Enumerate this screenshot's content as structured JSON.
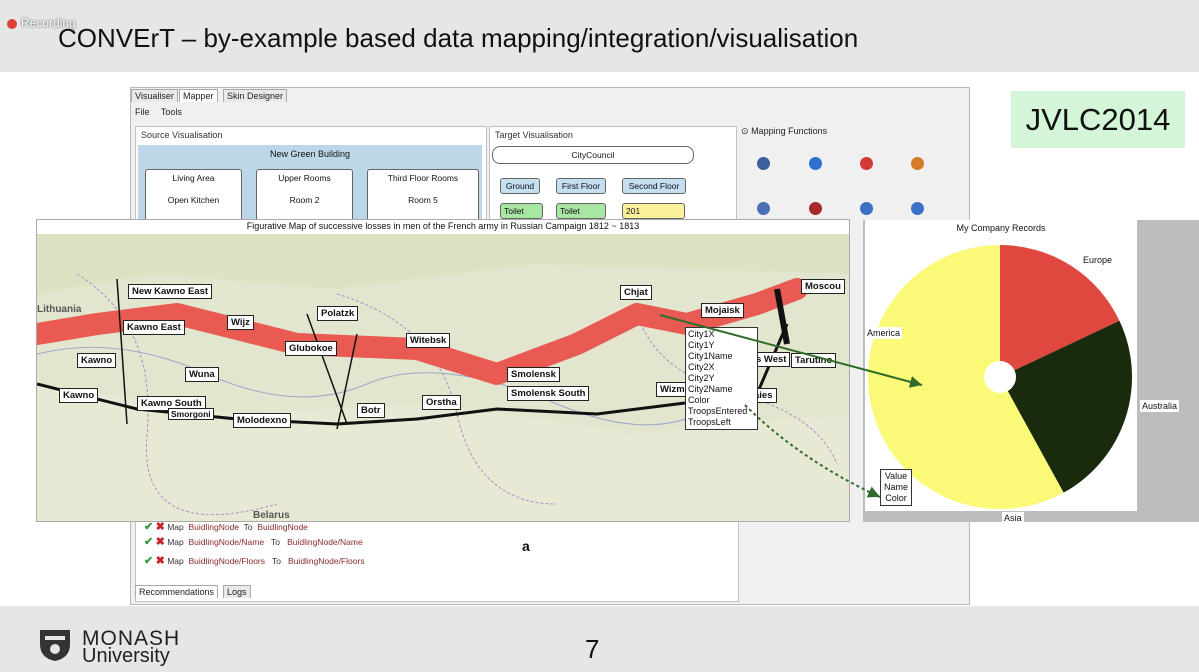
{
  "header": {
    "recording_label": "Recording",
    "title": "CONVErT – by-example based data mapping/integration/visualisation"
  },
  "badge": "JVLC2014",
  "footer": {
    "university_line1": "MONASH",
    "university_line2": "University",
    "slide_number": "7"
  },
  "app": {
    "tabs": [
      "Visualiser",
      "Mapper",
      "Skin Designer"
    ],
    "active_tab": "Mapper",
    "menu": [
      "File",
      "Tools"
    ],
    "source": {
      "title": "Source Visualisation",
      "root": "New Green Building",
      "children": [
        "Living Area",
        "Upper Rooms",
        "Third Floor Rooms"
      ],
      "leaves": [
        "Open Kitchen",
        "Room 2",
        "Room 5"
      ]
    },
    "target": {
      "title": "Target Visualisation",
      "root": "CityCouncil",
      "children": [
        "Ground",
        "First Floor",
        "Second Floor"
      ],
      "leaves": [
        "Toilet",
        "Toilet",
        "201"
      ]
    },
    "mapping_functions_title": "Mapping Functions",
    "mapping_function_icons": [
      "sync-icon",
      "plus-icon",
      "minus-icon",
      "network-icon",
      "swap-icon",
      "power-icon",
      "if-icon",
      "if-icon"
    ],
    "mappings": [
      {
        "action": "Map",
        "from": "BuidlingNode",
        "to_word": "To",
        "to": "BuidlingNode"
      },
      {
        "action": "Map",
        "from": "BuidlingNode/Name",
        "to_word": "To",
        "to": "BuidlingNode/Name"
      },
      {
        "action": "Map",
        "from": "BuidlingNode/Floors",
        "to_word": "To",
        "to": "BuidlingNode/Floors"
      }
    ],
    "caption": "a",
    "bottom_tabs": [
      "Recommendations",
      "Logs"
    ]
  },
  "map": {
    "title": "Figurative Map of successive losses in men of the French army in Russian Campaign 1812 ~ 1813",
    "country_labels": [
      "Lithuania",
      "Belarus"
    ],
    "cities": [
      "New Kawno East",
      "Kawno East",
      "Wijz",
      "Polatzk",
      "Witebsk",
      "Glubokoe",
      "Wuna",
      "Kawno",
      "Kawno",
      "Kawno South",
      "Smorgoni",
      "Molodexno",
      "Botr",
      "Orstha",
      "Smolensk",
      "Smolensk South",
      "Chjat",
      "Mojaisk",
      "Moscou",
      "Tarutino",
      "Wizma",
      "Malo-jaroslavetz West",
      "Maloyaroslaviets"
    ],
    "city_labels_visible": {
      "wizma": "Wizm",
      "malo_west": "s West",
      "malo": "aies",
      "tarutino": "Tarutino"
    },
    "context_menu": [
      "City1X",
      "City1Y",
      "City1Name",
      "City2X",
      "City2Y",
      "City2Name",
      "Color",
      "TroopsEntered",
      "TroopsLeft"
    ]
  },
  "pie": {
    "title": "My Company Records",
    "labels": [
      "Europe",
      "America",
      "Australia",
      "Asia"
    ],
    "legend": [
      "Value",
      "Name",
      "Color"
    ],
    "colors": {
      "Europe": "#e0473f",
      "Australia": "#1a2b0d",
      "America": "#fafa78",
      "Asia": "#fafa78"
    }
  },
  "chart_data": {
    "type": "pie",
    "title": "My Company Records",
    "slices": [
      {
        "label": "Europe",
        "value": 18
      },
      {
        "label": "Australia",
        "value": 24
      },
      {
        "label": "Asia",
        "value": 22
      },
      {
        "label": "America",
        "value": 36
      }
    ]
  }
}
